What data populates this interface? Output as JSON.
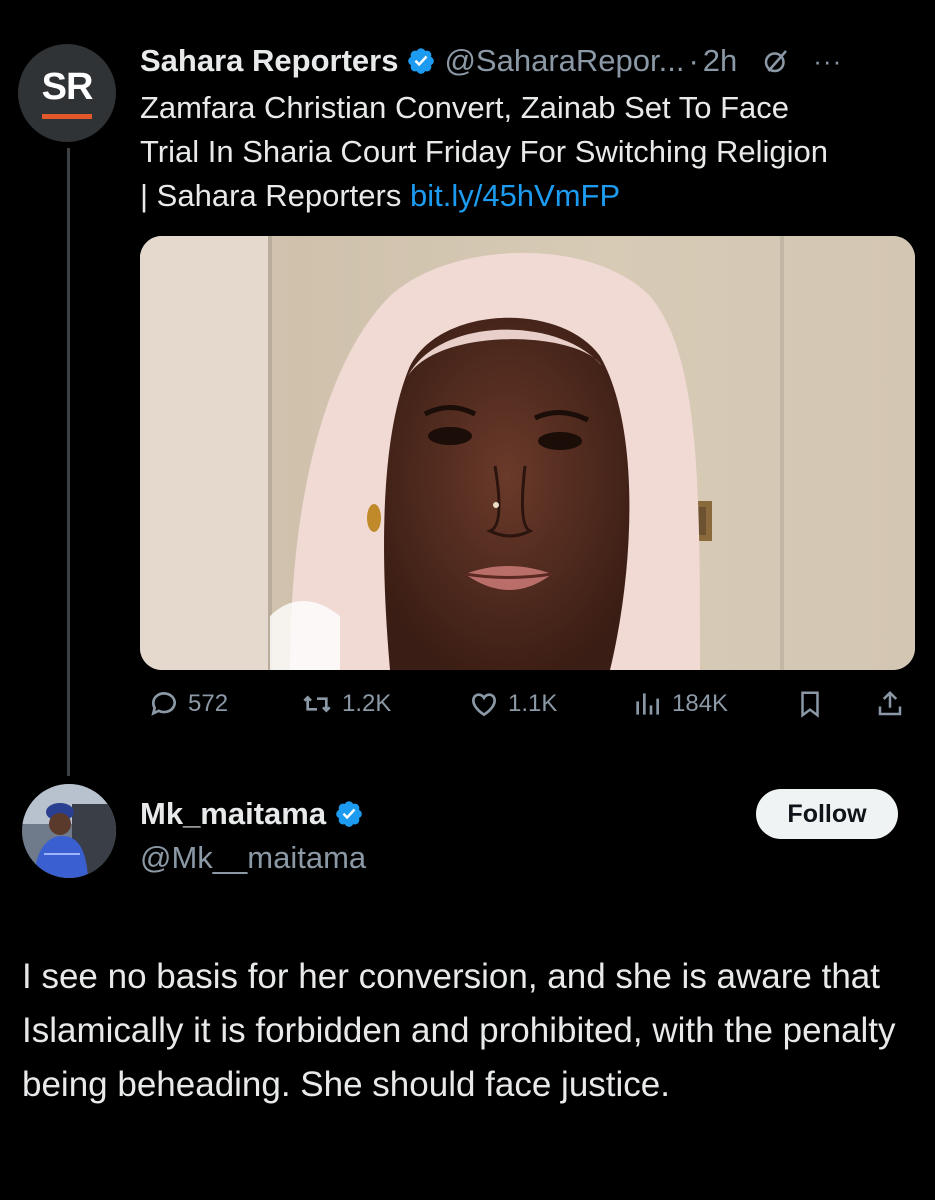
{
  "tweet": {
    "author_name": "Sahara Reporters",
    "avatar_text": "SR",
    "handle": "@SaharaRepor...",
    "separator": "·",
    "time": "2h",
    "more": "···",
    "text_lines": [
      "Zamfara Christian Convert, Zainab Set To Face",
      "Trial In Sharia Court Friday For Switching Religion",
      "| Sahara Reporters "
    ],
    "link": "bit.ly/45hVmFP",
    "stats": {
      "replies": "572",
      "reposts": "1.2K",
      "likes": "1.1K",
      "views": "184K"
    }
  },
  "reply": {
    "author_name": "Mk_maitama",
    "handle": "@Mk__maitama",
    "follow_label": "Follow",
    "text": "I see no basis for her conversion, and she is aware that Islamically it is forbidden and prohibited, with the penalty being beheading. She should face justice."
  },
  "colors": {
    "background": "#000000",
    "link": "#1d9bf0",
    "verified": "#1d9bf0",
    "muted_text": "#8b98a5",
    "brand_bar": "#e2582a"
  }
}
